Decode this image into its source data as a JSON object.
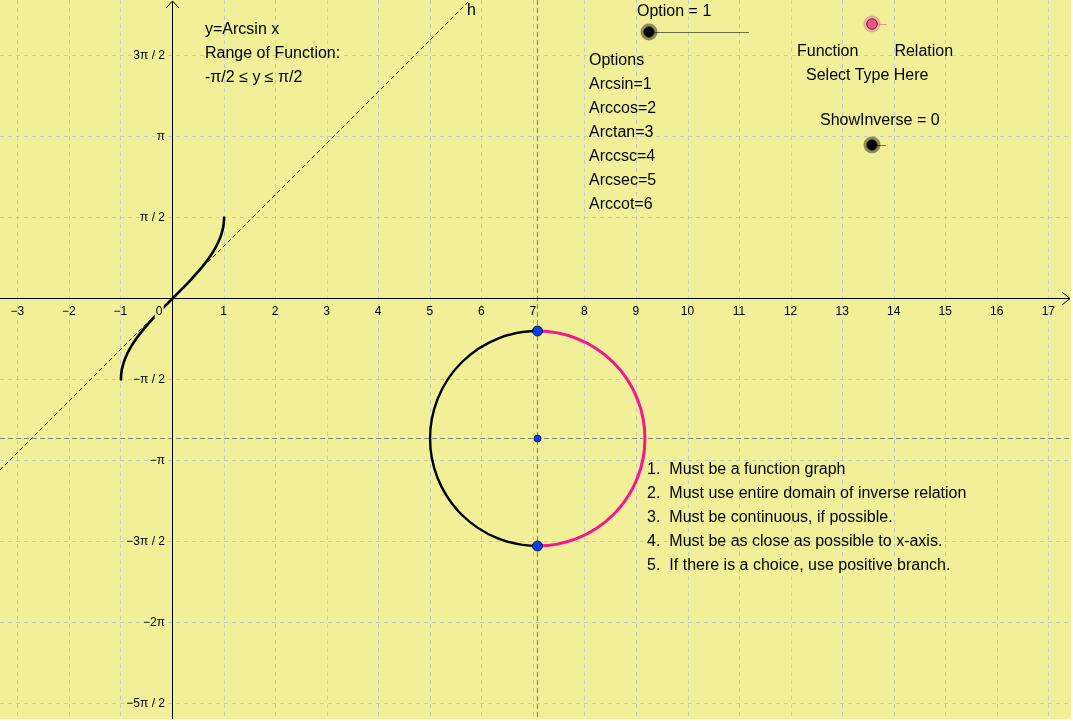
{
  "graph": {
    "x_tick_labels": [
      "−3",
      "−2",
      "−1",
      "0",
      "1",
      "2",
      "3",
      "4",
      "5",
      "6",
      "7",
      "8",
      "9",
      "10",
      "11",
      "12",
      "13",
      "14",
      "15",
      "16",
      "17"
    ],
    "y_tick_labels": [
      "3π / 2",
      "π",
      "π / 2",
      "−π / 2",
      "−π",
      "−3π / 2",
      "−2π",
      "−5π / 2"
    ],
    "line_label": "h"
  },
  "function_info": [
    "y=Arcsin x",
    "Range of Function:",
    "-π/2 ≤ y ≤ π/2"
  ],
  "controls": [
    {
      "kind": "slider",
      "label": "Option = 1",
      "level": 0,
      "color": "#000000"
    },
    {
      "kind": "toggle",
      "on": false,
      "color": "#f0508c"
    },
    {
      "kind": "toggle",
      "label": "ShowInverse = 0",
      "on": false,
      "color": "#000000"
    }
  ],
  "options": {
    "title": "Options",
    "items": [
      "Arcsin=1",
      "Arccos=2",
      "Arctan=3",
      "Arccsc=4",
      "Arcsec=5",
      "Arccot=6"
    ]
  },
  "type_selector": {
    "labels": [
      "Function",
      "Relation"
    ],
    "caption": "Select Type Here"
  },
  "rules": [
    {
      "number": "1.",
      "text": "Must be a function graph"
    },
    {
      "number": "2.",
      "text": "Must use entire domain of inverse relation"
    },
    {
      "number": "3.",
      "text": "Must be continuous, if possible."
    },
    {
      "number": "4.",
      "text": "Must be as close as possible to x-axis."
    },
    {
      "number": "5.",
      "text": "If there is a choice, use positive branch."
    }
  ]
}
